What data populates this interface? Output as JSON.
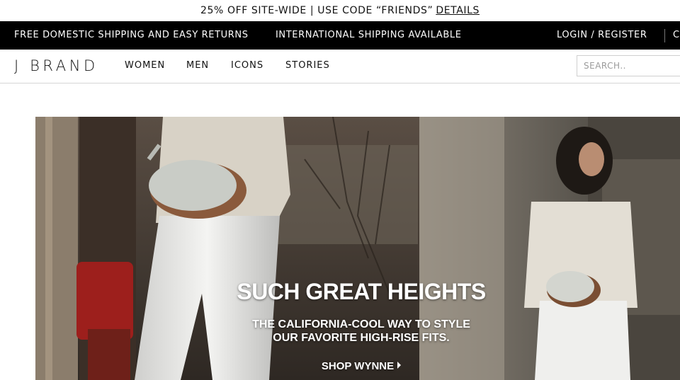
{
  "promo": {
    "text": "25% OFF SITE-WIDE | USE CODE “FRIENDS”",
    "link": "DETAILS"
  },
  "utility": {
    "shipping": "FREE DOMESTIC SHIPPING AND EASY RETURNS",
    "international": "INTERNATIONAL SHIPPING AVAILABLE",
    "login": "LOGIN / REGISTER",
    "cart": "C"
  },
  "nav": {
    "logo": "J BRAND",
    "links": [
      "WOMEN",
      "MEN",
      "ICONS",
      "STORIES"
    ],
    "search_placeholder": "SEARCH.."
  },
  "hero": {
    "title": "SUCH GREAT HEIGHTS",
    "subtitle_line1": "THE CALIFORNIA-COOL WAY TO STYLE",
    "subtitle_line2": "OUR FAVORITE HIGH-RISE FITS.",
    "cta": "SHOP WYNNE",
    "cta_icon": "caret-right-icon"
  },
  "colors": {
    "utility_bar": "#000000",
    "text": "#111111",
    "hero_text": "#ffffff"
  }
}
